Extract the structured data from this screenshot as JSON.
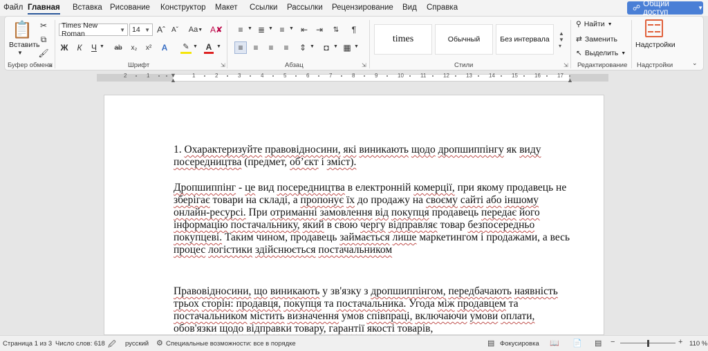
{
  "menu": {
    "tabs": [
      "Файл",
      "Главная",
      "Вставка",
      "Рисование",
      "Конструктор",
      "Макет",
      "Ссылки",
      "Рассылки",
      "Рецензирование",
      "Вид",
      "Справка"
    ],
    "active": "Главная",
    "share_label": "Общий доступ"
  },
  "ribbon": {
    "clipboard": {
      "paste_label": "Вставить",
      "group_label": "Буфер обмена"
    },
    "font": {
      "family": "Times New Roman",
      "size": "14",
      "aa_label": "Aa",
      "bold": "Ж",
      "italic": "К",
      "underline": "Ч",
      "group_label": "Шрифт"
    },
    "paragraph": {
      "group_label": "Абзац"
    },
    "styles": {
      "items": [
        "times",
        "Обычный",
        "Без интервала"
      ],
      "group_label": "Стили"
    },
    "editing": {
      "find_label": "Найти",
      "replace_label": "Заменить",
      "select_label": "Выделить",
      "group_label": "Редактирование"
    },
    "addins": {
      "button_label": "Надстройки",
      "group_label": "Надстройки"
    }
  },
  "ruler": {
    "numbers": [
      "2",
      "1",
      "1",
      "2",
      "3",
      "4",
      "5",
      "6",
      "7",
      "8",
      "9",
      "10",
      "11",
      "12",
      "13",
      "14",
      "15",
      "16",
      "17"
    ]
  },
  "document": {
    "paragraphs": [
      "1. Охарактеризуйте правовідносини, які виникають щодо дропшиппінгу як виду посередництва (предмет, об’єкт і зміст).",
      "Дропшиппінг - це вид посередництва в електронній комерції, при якому продавець не зберігає товари на складі, а пропонує їх до продажу на своєму сайті або іншому онлайн-ресурсі. При отриманні замовлення від покупця продавець передає його інформацію постачальнику, який в свою чергу відправляє товар безпосередньо покупцеві. Таким чином, продавець займається лише маркетингом і продажами, а весь процес логістики здійснюється постачальником",
      "Правовідносини, що виникають у зв'язку з дропшиппінгом, передбачають наявність трьох сторін: продавця, покупця та постачальника. Угода між продавцем та постачальником містить визначення умов співпраці, включаючи умови оплати, обов'язки щодо відправки товару, гарантії якості товарів,"
    ]
  },
  "status": {
    "page": "Страница 1 из 3",
    "words": "Число слов: 618",
    "language": "русский",
    "accessibility": "Специальные возможности: все в порядке",
    "focus": "Фокусировка",
    "zoom": "110 %",
    "zoom_level": 0.5
  },
  "colors": {
    "accent": "#2b579a",
    "share_button": "#4a7fd6",
    "spell_squiggle": "#c0504d"
  }
}
